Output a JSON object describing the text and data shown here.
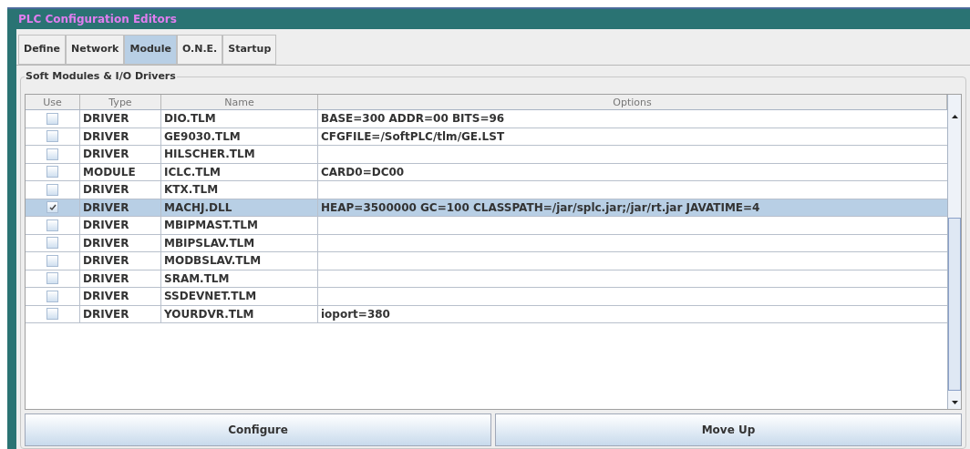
{
  "window": {
    "title": "PLC Configuration Editors"
  },
  "tabs": [
    {
      "label": "Define",
      "selected": false
    },
    {
      "label": "Network",
      "selected": false
    },
    {
      "label": "Module",
      "selected": true
    },
    {
      "label": "O.N.E.",
      "selected": false
    },
    {
      "label": "Startup",
      "selected": false
    }
  ],
  "group": {
    "title": "Soft Modules & I/O Drivers"
  },
  "table": {
    "columns": [
      "Use",
      "Type",
      "Name",
      "Options"
    ],
    "rows": [
      {
        "checked": false,
        "selected": false,
        "type": "DRIVER",
        "name": "DIO.TLM",
        "options": "BASE=300 ADDR=00 BITS=96"
      },
      {
        "checked": false,
        "selected": false,
        "type": "DRIVER",
        "name": "GE9030.TLM",
        "options": "CFGFILE=/SoftPLC/tlm/GE.LST"
      },
      {
        "checked": false,
        "selected": false,
        "type": "DRIVER",
        "name": "HILSCHER.TLM",
        "options": ""
      },
      {
        "checked": false,
        "selected": false,
        "type": "MODULE",
        "name": "ICLC.TLM",
        "options": "CARD0=DC00"
      },
      {
        "checked": false,
        "selected": false,
        "type": "DRIVER",
        "name": "KTX.TLM",
        "options": ""
      },
      {
        "checked": true,
        "selected": true,
        "type": "DRIVER",
        "name": "MACHJ.DLL",
        "options": "HEAP=3500000 GC=100 CLASSPATH=/jar/splc.jar;/jar/rt.jar JAVATIME=4"
      },
      {
        "checked": false,
        "selected": false,
        "type": "DRIVER",
        "name": "MBIPMAST.TLM",
        "options": ""
      },
      {
        "checked": false,
        "selected": false,
        "type": "DRIVER",
        "name": "MBIPSLAV.TLM",
        "options": ""
      },
      {
        "checked": false,
        "selected": false,
        "type": "DRIVER",
        "name": "MODBSLAV.TLM",
        "options": ""
      },
      {
        "checked": false,
        "selected": false,
        "type": "DRIVER",
        "name": "SRAM.TLM",
        "options": ""
      },
      {
        "checked": false,
        "selected": false,
        "type": "DRIVER",
        "name": "SSDEVNET.TLM",
        "options": ""
      },
      {
        "checked": false,
        "selected": false,
        "type": "DRIVER",
        "name": "YOURDVR.TLM",
        "options": "ioport=380"
      }
    ]
  },
  "buttons": [
    "Configure",
    "Move Up"
  ]
}
